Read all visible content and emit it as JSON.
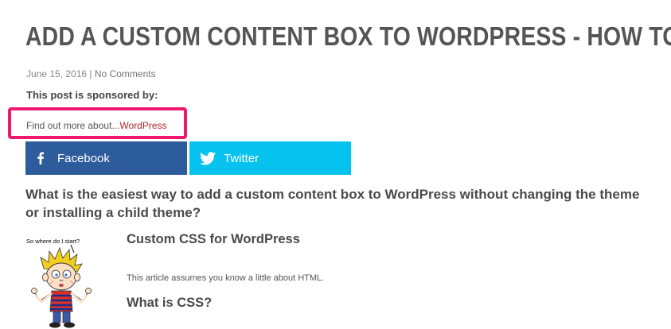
{
  "post": {
    "title": "ADD A CUSTOM CONTENT BOX TO WORDPRESS - HOW TO.",
    "date": "June 15, 2016",
    "separator": "|",
    "comments": "No Comments"
  },
  "sponsor": {
    "label": "This post is sponsored by:",
    "text": "Find out more about...",
    "link": "WordPress",
    "border_color": "#f2176e",
    "link_color": "#b2232e"
  },
  "share": {
    "facebook": {
      "label": "Facebook",
      "icon": "facebook-icon",
      "color": "#2d5c9c"
    },
    "twitter": {
      "label": "Twitter",
      "icon": "twitter-icon",
      "color": "#06c2ef"
    }
  },
  "content": {
    "question": "What is the easiest way to add a custom content box to WordPress without changing the theme or installing a child theme?",
    "image_caption": "So where do I start?",
    "heading_custom": "Custom CSS for WordPress",
    "note": "This article assumes you know a little about HTML.",
    "heading_what": "What is CSS?"
  }
}
